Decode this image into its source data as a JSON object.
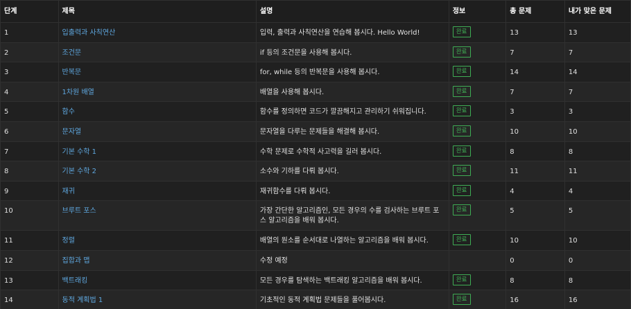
{
  "table": {
    "headers": {
      "level": "단계",
      "title": "제목",
      "desc": "설명",
      "info": "정보",
      "total": "총 문제",
      "solved": "내가 맞은 문제"
    },
    "rows": [
      {
        "level": "1",
        "title": "입출력과 사칙연산",
        "desc": "입력, 출력과 사칙연산을 연습해 봅시다. Hello World!",
        "badge": "완료",
        "total": "13",
        "solved": "13"
      },
      {
        "level": "2",
        "title": "조건문",
        "desc": "if 등의 조건문을 사용해 봅시다.",
        "badge": "완료",
        "total": "7",
        "solved": "7"
      },
      {
        "level": "3",
        "title": "반복문",
        "desc": "for, while 등의 반복문을 사용해 봅시다.",
        "badge": "완료",
        "total": "14",
        "solved": "14"
      },
      {
        "level": "4",
        "title": "1차원 배열",
        "desc": "배열을 사용해 봅시다.",
        "badge": "완료",
        "total": "7",
        "solved": "7"
      },
      {
        "level": "5",
        "title": "함수",
        "desc": "함수를 정의하면 코드가 깔끔해지고 관리하기 쉬워집니다.",
        "badge": "완료",
        "total": "3",
        "solved": "3"
      },
      {
        "level": "6",
        "title": "문자열",
        "desc": "문자열을 다루는 문제들을 해결해 봅시다.",
        "badge": "완료",
        "total": "10",
        "solved": "10"
      },
      {
        "level": "7",
        "title": "기본 수학 1",
        "desc": "수학 문제로 수학적 사고력을 길러 봅시다.",
        "badge": "완료",
        "total": "8",
        "solved": "8"
      },
      {
        "level": "8",
        "title": "기본 수학 2",
        "desc": "소수와 기하를 다뤄 봅시다.",
        "badge": "완료",
        "total": "11",
        "solved": "11"
      },
      {
        "level": "9",
        "title": "재귀",
        "desc": "재귀함수를 다뤄 봅시다.",
        "badge": "완료",
        "total": "4",
        "solved": "4"
      },
      {
        "level": "10",
        "title": "브루트 포스",
        "desc": "가장 간단한 알고리즘인, 모든 경우의 수를 검사하는 브루트 포스 알고리즘을 배워 봅시다.",
        "badge": "완료",
        "total": "5",
        "solved": "5"
      },
      {
        "level": "11",
        "title": "정렬",
        "desc": "배열의 원소를 순서대로 나열하는 알고리즘을 배워 봅시다.",
        "badge": "완료",
        "total": "10",
        "solved": "10"
      },
      {
        "level": "12",
        "title": "집합과 맵",
        "desc": "수정 예정",
        "badge": "",
        "total": "0",
        "solved": "0"
      },
      {
        "level": "13",
        "title": "백트래킹",
        "desc": "모든 경우를 탐색하는 백트래킹 알고리즘을 배워 봅시다.",
        "badge": "완료",
        "total": "8",
        "solved": "8"
      },
      {
        "level": "14",
        "title": "동적 계획법 1",
        "desc": "기초적인 동적 계획법 문제들을 풀어봅시다.",
        "badge": "완료",
        "total": "16",
        "solved": "16"
      }
    ]
  },
  "colors": {
    "background": "#1c1c1c",
    "link": "#5fa8e0",
    "badge": "#3fae54",
    "border": "#303030"
  }
}
